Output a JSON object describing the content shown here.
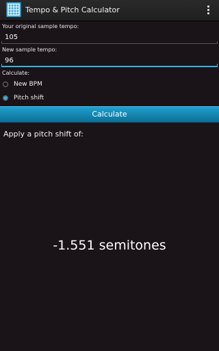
{
  "app": {
    "title": "Tempo & Pitch Calculator",
    "icon": "grid-app-icon",
    "menu_icon": "overflow-menu-icon"
  },
  "form": {
    "original_tempo": {
      "label": "Your original sample tempo:",
      "value": "105"
    },
    "new_tempo": {
      "label": "New sample tempo:",
      "value": "96"
    },
    "calculate_label": "Calculate:",
    "options": [
      {
        "label": "New BPM",
        "checked": false
      },
      {
        "label": "Pitch shift",
        "checked": true
      }
    ],
    "button_label": "Calculate"
  },
  "result": {
    "intro": "Apply a pitch shift of:",
    "value": "-1.551 semitones"
  },
  "colors": {
    "accent": "#33b5e5",
    "background": "#1a1317",
    "button_top": "#1fa0d0",
    "button_bottom": "#0c6f96"
  }
}
